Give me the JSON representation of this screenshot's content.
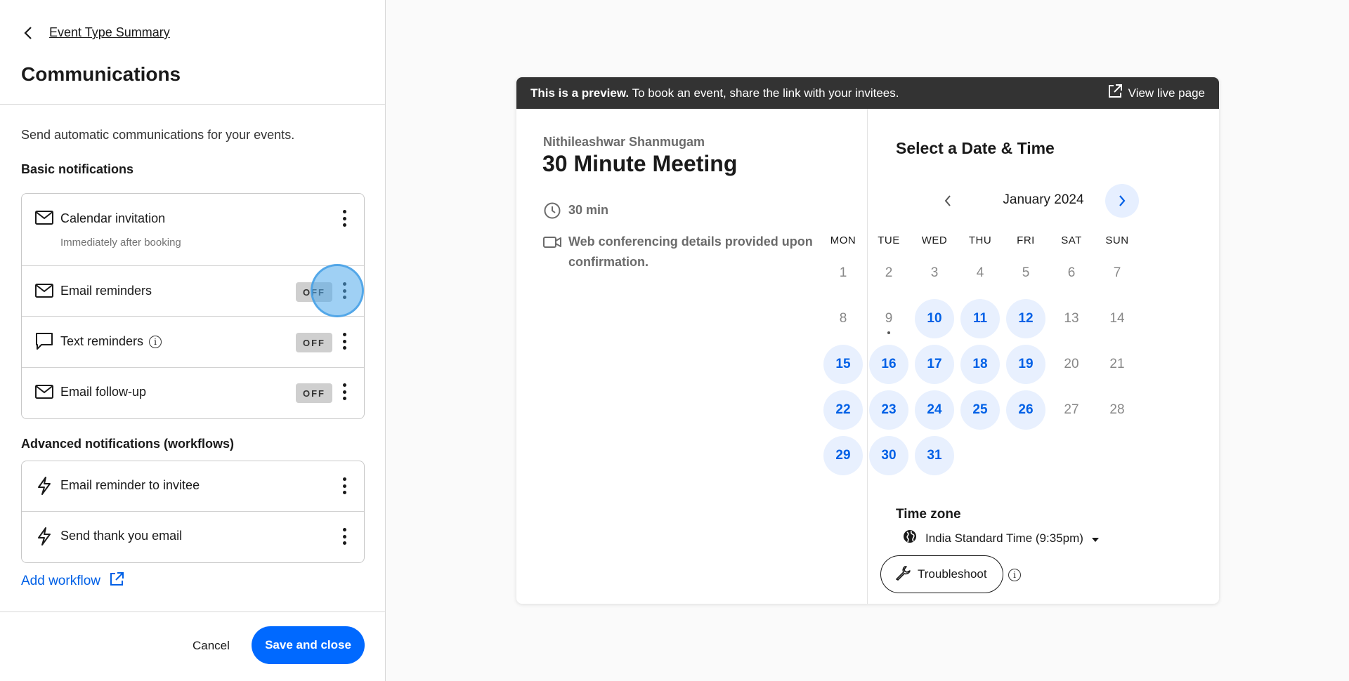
{
  "sidebar": {
    "back_label": "Event Type Summary",
    "title": "Communications",
    "description": "Send automatic communications for your events.",
    "basic_heading": "Basic notifications",
    "basic_items": [
      {
        "label": "Calendar invitation",
        "sublabel": "Immediately after booking",
        "icon": "mail-icon"
      },
      {
        "label": "Email reminders",
        "toggle": "OFF",
        "icon": "mail-icon"
      },
      {
        "label": "Text reminders",
        "toggle": "OFF",
        "icon": "chat-bubble-icon"
      },
      {
        "label": "Email follow-up",
        "toggle": "OFF",
        "icon": "mail-icon"
      }
    ],
    "advanced_heading": "Advanced notifications (workflows)",
    "advanced_items": [
      {
        "label": "Email reminder to invitee",
        "icon": "bolt-icon"
      },
      {
        "label": "Send thank you email",
        "icon": "bolt-icon"
      }
    ],
    "add_workflow": "Add workflow",
    "cancel": "Cancel",
    "save": "Save and close"
  },
  "preview": {
    "banner_bold": "This is a preview.",
    "banner_text": "To book an event, share the link with your invitees.",
    "view_live": "View live page",
    "host": "Nithileashwar Shanmugam",
    "event_title": "30 Minute Meeting",
    "duration": "30 min",
    "conferencing": "Web conferencing details provided upon confirmation.",
    "select_title": "Select a Date & Time",
    "month": "January 2024",
    "weekdays": [
      "MON",
      "TUE",
      "WED",
      "THU",
      "FRI",
      "SAT",
      "SUN"
    ],
    "available_days": [
      10,
      11,
      12,
      15,
      16,
      17,
      18,
      19,
      22,
      23,
      24,
      25,
      26,
      29,
      30,
      31
    ],
    "today": 9,
    "timezone_heading": "Time zone",
    "timezone": "India Standard Time (9:35pm)",
    "troubleshoot": "Troubleshoot"
  },
  "colors": {
    "accent": "#0069ff",
    "link": "#0060e6",
    "available_bg": "#e8f0fe"
  }
}
